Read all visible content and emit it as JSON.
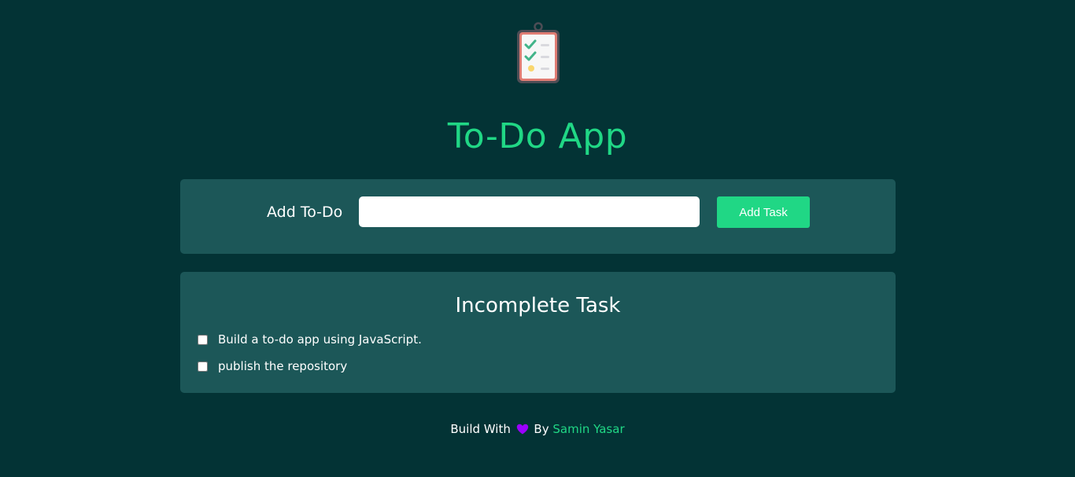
{
  "app": {
    "title": "To-Do App",
    "logo_icon": "clipboard-checklist-icon"
  },
  "add_form": {
    "label": "Add To-Do",
    "input_value": "",
    "input_placeholder": "",
    "button_label": "Add Task"
  },
  "incomplete": {
    "heading": "Incomplete Task",
    "items": [
      {
        "label": "Build a to-do app using JavaScript.",
        "checked": false
      },
      {
        "label": "publish the repository",
        "checked": false
      }
    ]
  },
  "footer": {
    "prefix": "Build With",
    "heart_icon": "heart-icon",
    "by": "By",
    "author": "Samin Yasar"
  },
  "colors": {
    "background": "#033335",
    "card": "#1c5758",
    "accent": "#20d785",
    "heart": "#9b00ff"
  }
}
